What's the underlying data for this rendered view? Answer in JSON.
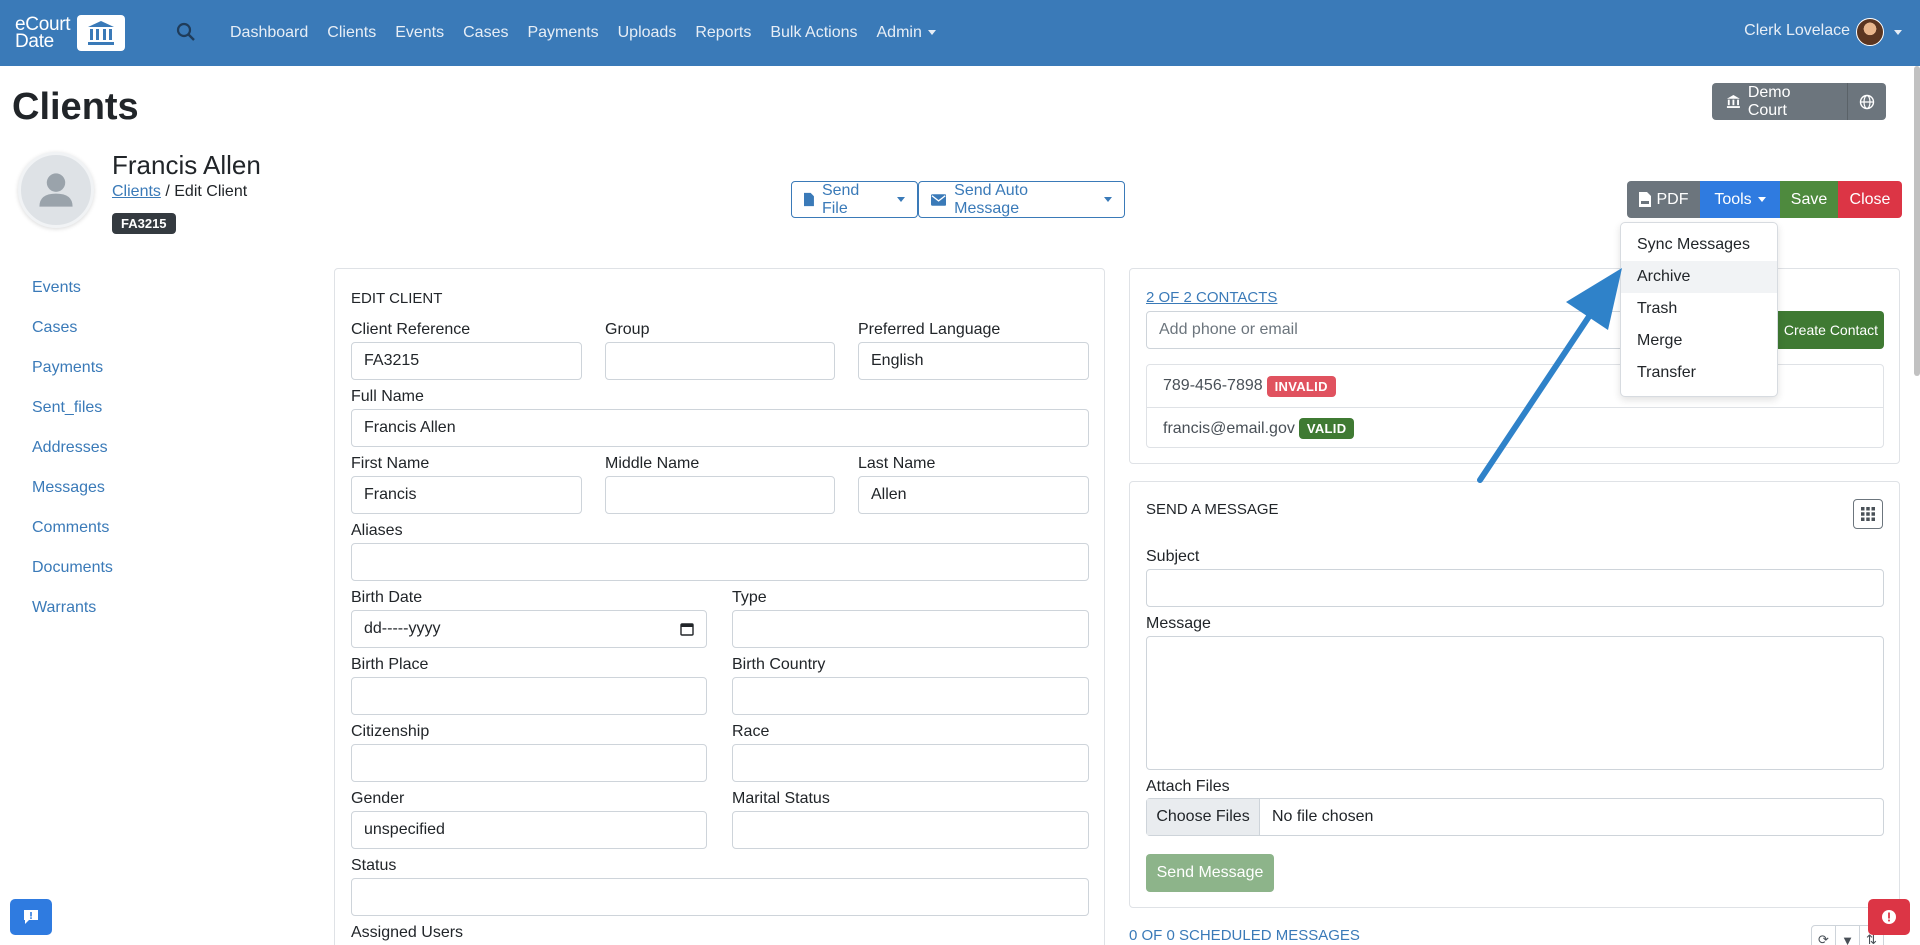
{
  "navbar": {
    "brand_line1": "eCourt",
    "brand_line2": "Date",
    "links": [
      "Dashboard",
      "Clients",
      "Events",
      "Cases",
      "Payments",
      "Uploads",
      "Reports",
      "Bulk Actions",
      "Admin"
    ],
    "user_name": "Clerk Lovelace"
  },
  "page": {
    "title": "Clients",
    "court_button": "Demo Court"
  },
  "client": {
    "name": "Francis Allen",
    "breadcrumb_link": "Clients",
    "breadcrumb_rest": " / Edit Client",
    "reference_badge": "FA3215"
  },
  "actions": {
    "send_file": "Send File",
    "send_auto_message": "Send Auto Message"
  },
  "toolbar": {
    "pdf": "PDF",
    "tools": "Tools",
    "save": "Save",
    "close": "Close"
  },
  "tools_menu": {
    "items": [
      "Sync Messages",
      "Archive",
      "Trash",
      "Merge",
      "Transfer"
    ],
    "highlighted": "Archive"
  },
  "sidenav": [
    "Events",
    "Cases",
    "Payments",
    "Sent_files",
    "Addresses",
    "Messages",
    "Comments",
    "Documents",
    "Warrants"
  ],
  "edit_client": {
    "title": "EDIT CLIENT",
    "client_reference": {
      "label": "Client Reference",
      "value": "FA3215"
    },
    "group": {
      "label": "Group",
      "value": ""
    },
    "preferred_language": {
      "label": "Preferred Language",
      "value": "English"
    },
    "full_name": {
      "label": "Full Name",
      "value": "Francis Allen"
    },
    "first_name": {
      "label": "First Name",
      "value": "Francis"
    },
    "middle_name": {
      "label": "Middle Name",
      "value": ""
    },
    "last_name": {
      "label": "Last Name",
      "value": "Allen"
    },
    "aliases": {
      "label": "Aliases",
      "value": ""
    },
    "birth_date": {
      "label": "Birth Date",
      "value": "dd-----yyyy"
    },
    "type": {
      "label": "Type",
      "value": ""
    },
    "birth_place": {
      "label": "Birth Place",
      "value": ""
    },
    "birth_country": {
      "label": "Birth Country",
      "value": ""
    },
    "citizenship": {
      "label": "Citizenship",
      "value": ""
    },
    "race": {
      "label": "Race",
      "value": ""
    },
    "gender": {
      "label": "Gender",
      "value": "unspecified"
    },
    "marital_status": {
      "label": "Marital Status",
      "value": ""
    },
    "status": {
      "label": "Status",
      "value": ""
    },
    "assigned_users": {
      "label": "Assigned Users"
    }
  },
  "contacts": {
    "header": "2 OF 2 CONTACTS",
    "input_placeholder": "Add phone or email",
    "create_button": "Create Contact",
    "list": [
      {
        "value": "789-456-7898",
        "badge": "INVALID"
      },
      {
        "value": "francis@email.gov",
        "badge": "VALID"
      }
    ]
  },
  "send_message": {
    "title": "SEND A MESSAGE",
    "subject_label": "Subject",
    "message_label": "Message",
    "attach_label": "Attach Files",
    "choose_files": "Choose Files",
    "no_file": "No file chosen",
    "send_button": "Send Message"
  },
  "scheduled": {
    "header": "0 OF 0 SCHEDULED MESSAGES"
  },
  "colors": {
    "navbar": "#3a7ab8",
    "primary": "#2f7be0",
    "success": "#4e8a3e",
    "danger": "#dc3545",
    "secondary": "#6c757d"
  }
}
